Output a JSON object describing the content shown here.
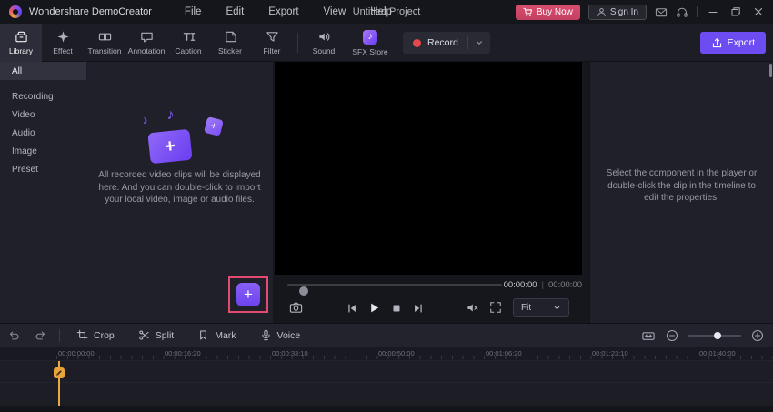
{
  "titlebar": {
    "app_name": "Wondershare DemoCreator",
    "menus": [
      "File",
      "Edit",
      "Export",
      "View",
      "Help"
    ],
    "project_title": "Untitled Project",
    "buy_now_label": "Buy Now",
    "sign_in_label": "Sign In"
  },
  "toolbar": {
    "tabs": [
      {
        "label": "Library",
        "active": true
      },
      {
        "label": "Effect"
      },
      {
        "label": "Transition"
      },
      {
        "label": "Annotation"
      },
      {
        "label": "Caption"
      },
      {
        "label": "Sticker"
      },
      {
        "label": "Filter"
      },
      {
        "label": "Sound"
      },
      {
        "label": "SFX Store"
      }
    ],
    "record_label": "Record",
    "export_label": "Export"
  },
  "sidebar": {
    "items": [
      {
        "label": "All",
        "active": true
      },
      {
        "label": "Recording"
      },
      {
        "label": "Video"
      },
      {
        "label": "Audio"
      },
      {
        "label": "Image"
      },
      {
        "label": "Preset"
      }
    ]
  },
  "library": {
    "empty_text": "All recorded video clips will be displayed here. And you can double-click to import your local video, image or audio files."
  },
  "player": {
    "current_time": "00:00:00",
    "time_separator": "|",
    "total_time": "00:00:00",
    "fit_label": "Fit"
  },
  "properties": {
    "empty_text": "Select the component in the player or double-click the clip in the timeline to edit the properties."
  },
  "timeline_toolbar": {
    "crop_label": "Crop",
    "split_label": "Split",
    "mark_label": "Mark",
    "voice_label": "Voice"
  },
  "timeline": {
    "ruler_labels": [
      "00:00:00:00",
      "00:00:16:20",
      "00:00:33:10",
      "00:00:50:00",
      "00:01:06:20",
      "00:01:23:10",
      "00:01:40:00"
    ]
  },
  "icons": {
    "plus": "+",
    "note": "♪"
  },
  "colors": {
    "accent_purple": "#6d4cf2",
    "buy_now_red": "#cf4766",
    "record_dot_red": "#e5484d",
    "highlight_box_red": "#e34a6f",
    "playhead_yellow": "#e8a33d"
  }
}
